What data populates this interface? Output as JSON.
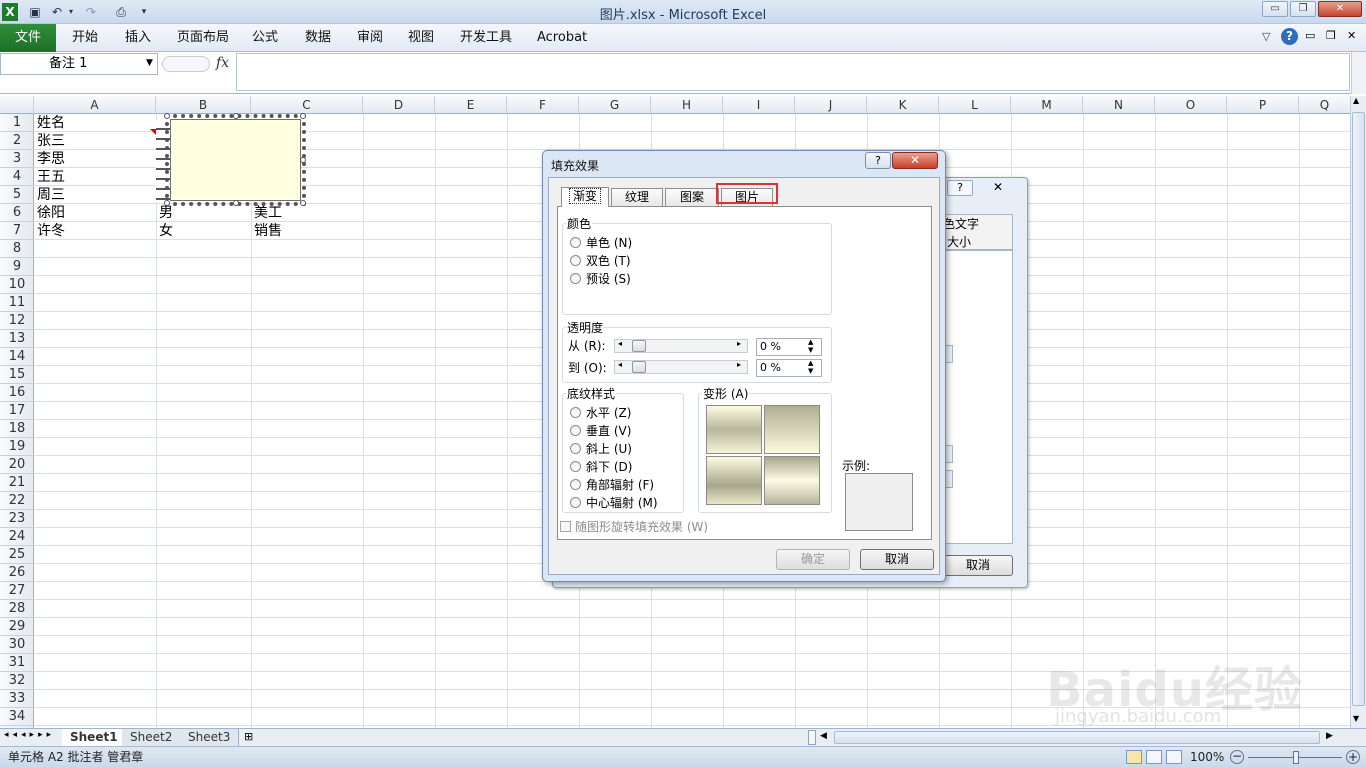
{
  "window": {
    "title": "图片.xlsx - Microsoft Excel"
  },
  "ribbon": {
    "file": "文件",
    "tabs": [
      "开始",
      "插入",
      "页面布局",
      "公式",
      "数据",
      "审阅",
      "视图",
      "开发工具",
      "Acrobat"
    ]
  },
  "formula_bar": {
    "name_box": "备注 1",
    "fx": "fx",
    "value": ""
  },
  "columns": [
    "A",
    "B",
    "C",
    "D",
    "E",
    "F",
    "G",
    "H",
    "I",
    "J",
    "K",
    "L",
    "M",
    "N",
    "O",
    "P",
    "Q"
  ],
  "rows": [
    "1",
    "2",
    "3",
    "4",
    "5",
    "6",
    "7",
    "8",
    "9",
    "10",
    "11",
    "12",
    "13",
    "14",
    "15",
    "16",
    "17",
    "18",
    "19",
    "20",
    "21",
    "22",
    "23",
    "24",
    "25",
    "26",
    "27",
    "28",
    "29",
    "30",
    "31",
    "32",
    "33",
    "34"
  ],
  "cells": {
    "A": [
      "姓名",
      "张三",
      "李思",
      "王五",
      "周三",
      "徐阳",
      "许冬"
    ],
    "B_visible": {
      "r6": "男",
      "r7": "女"
    },
    "C_visible": {
      "r6": "美工",
      "r7": "销售"
    }
  },
  "sheets": [
    "Sheet1",
    "Sheet2",
    "Sheet3"
  ],
  "status": {
    "text": "单元格 A2 批注者 管君章",
    "zoom": "100%"
  },
  "back_dialog": {
    "tab_fragment_1": "色文字",
    "tab_fragment_2": "大小",
    "cancel": "取消"
  },
  "dialog": {
    "title": "填充效果",
    "help": "?",
    "close": "✕",
    "tabs": [
      "渐变",
      "纹理",
      "图案",
      "图片"
    ],
    "selected_tab": "渐变",
    "highlighted_tab": "图片",
    "color_group": {
      "label": "颜色",
      "options": [
        "单色 (N)",
        "双色 (T)",
        "预设 (S)"
      ]
    },
    "transparency": {
      "label": "透明度",
      "from_label": "从 (R):",
      "to_label": "到 (O):",
      "from_value": "0 %",
      "to_value": "0 %"
    },
    "shading": {
      "label": "底纹样式",
      "options": [
        "水平 (Z)",
        "垂直 (V)",
        "斜上 (U)",
        "斜下 (D)",
        "角部辐射 (F)",
        "中心辐射 (M)"
      ]
    },
    "variants": {
      "label": "变形 (A)"
    },
    "sample": {
      "label": "示例:"
    },
    "rotate_checkbox": "随图形旋转填充效果 (W)",
    "ok": "确定",
    "cancel": "取消"
  },
  "watermark": {
    "brand": "Baidu经验",
    "url": "jingyan.baidu.com"
  }
}
